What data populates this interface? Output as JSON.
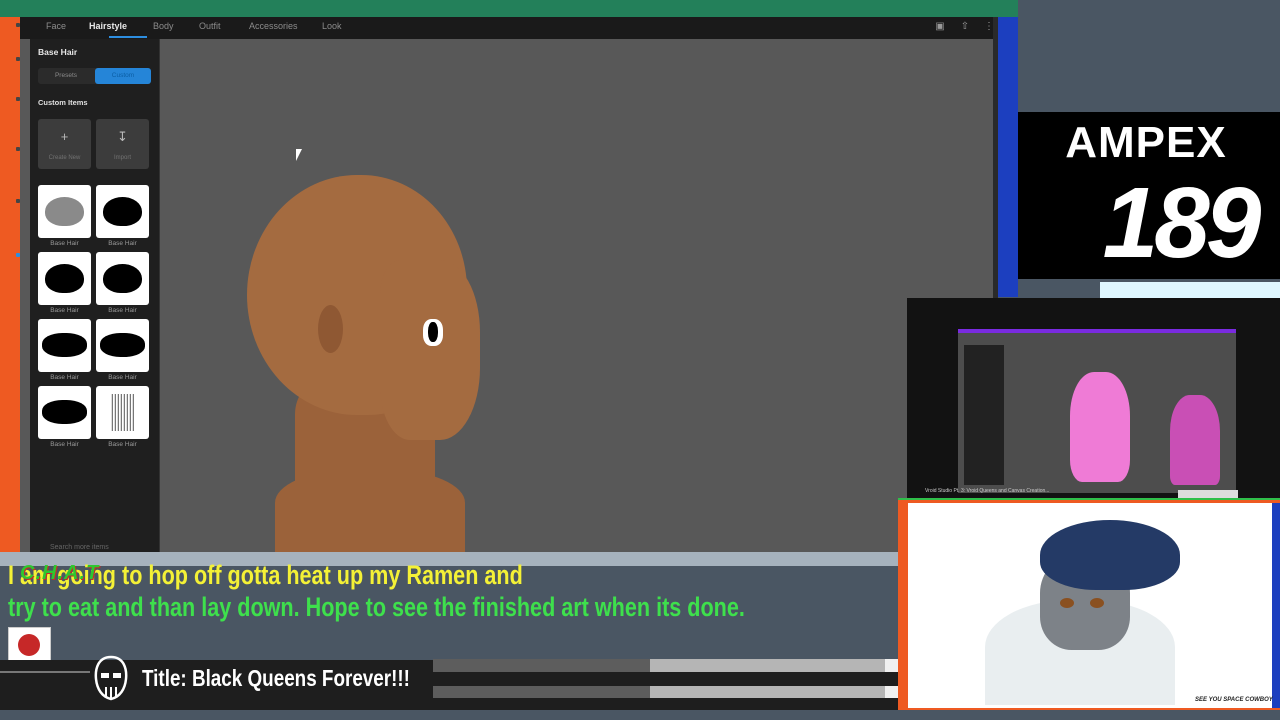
{
  "app": {
    "tabs": [
      {
        "label": "Face",
        "active": false
      },
      {
        "label": "Hairstyle",
        "active": true
      },
      {
        "label": "Body",
        "active": false
      },
      {
        "label": "Outfit",
        "active": false
      },
      {
        "label": "Accessories",
        "active": false
      },
      {
        "label": "Look",
        "active": false
      }
    ],
    "toolbar_icons": [
      "camera-icon",
      "share-icon",
      "more-vert-icon"
    ]
  },
  "panel": {
    "title": "Base Hair",
    "segments": [
      "Presets",
      "Custom"
    ],
    "active_segment": "Custom",
    "custom_items_label": "Custom Items",
    "actions": [
      {
        "label": "Create New",
        "icon": "plus-icon"
      },
      {
        "label": "Import",
        "icon": "import-icon"
      }
    ],
    "items": [
      {
        "label": "Base Hair",
        "style": "grey-cap"
      },
      {
        "label": "Base Hair",
        "style": "black-cap"
      },
      {
        "label": "Base Hair",
        "style": "black-cap"
      },
      {
        "label": "Base Hair",
        "style": "black-cap"
      },
      {
        "label": "Base Hair",
        "style": "wide-cap"
      },
      {
        "label": "Base Hair",
        "style": "wide-cap"
      },
      {
        "label": "Base Hair",
        "style": "wide-cap"
      },
      {
        "label": "Base Hair",
        "style": "strands"
      }
    ],
    "footer": "Search more items"
  },
  "stream": {
    "chat_logo": "C.H.A.T",
    "chat_line_1": "I am going to hop off gotta heat up my Ramen and",
    "chat_line_2": "try to eat and than lay down. Hope to see the finished art when its done.",
    "title": "Title: Black Queens Forever!!!",
    "brand": "AMPEX",
    "number": "189",
    "webcam_watermark": "SEE YOU SPACE COWBOY",
    "mini_caption": "Vroid Studio Pt. 3: Vroid Queens and Canvas Creation..."
  },
  "colors": {
    "accent": "#2585d8",
    "stream_green": "#3ee04c",
    "stream_orange": "#ee5a22",
    "stream_blue": "#1c3fbf",
    "top_green": "#23805a"
  }
}
